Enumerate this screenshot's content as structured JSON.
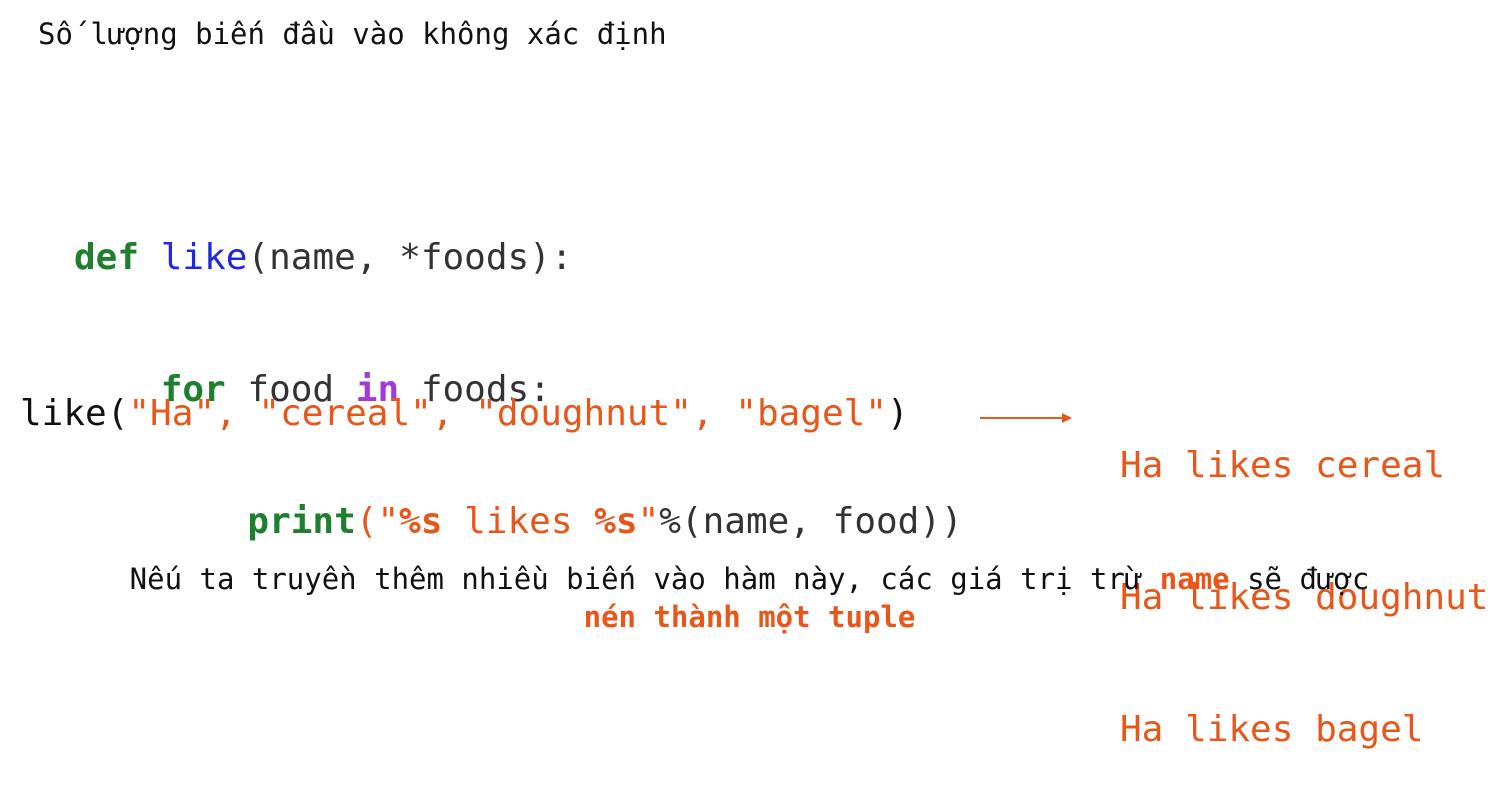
{
  "title": "Số lượng biến đầu vào không xác định",
  "code": {
    "line1": {
      "kw_def": "def",
      "fn_name": "like",
      "signature": "(name, *foods):"
    },
    "line2": {
      "indent": "    ",
      "kw_for": "for",
      "mid": " food ",
      "kw_in": "in",
      "tail": " foods:"
    },
    "line3": {
      "indent": "        ",
      "kw_print": "print",
      "open": "(\"",
      "fmt1": "%s",
      "likes": " likes ",
      "fmt2": "%s",
      "close_quote": "\"",
      "tail": "%(name, food))"
    }
  },
  "call": {
    "fn": "like(",
    "arg1": "\"Ha\", ",
    "arg2": "\"cereal\", ",
    "arg3": "\"doughnut\", ",
    "arg4": "\"bagel\"",
    "close": ")"
  },
  "output": [
    "Ha likes cereal",
    "Ha likes doughnut",
    "Ha likes bagel"
  ],
  "note": {
    "part1": "Nếu ta truyền thêm nhiều biến vào hàm này, các giá trị trừ ",
    "highlight1": "name",
    "part2": " sẽ được",
    "highlight2": "nén thành một tuple"
  },
  "colors": {
    "keyword_green": "#1e7f2e",
    "keyword_purple": "#a33ad8",
    "function_blue": "#1f28e0",
    "string_orange": "#e8561a"
  },
  "icons": {
    "arrow": "right-arrow-icon"
  }
}
